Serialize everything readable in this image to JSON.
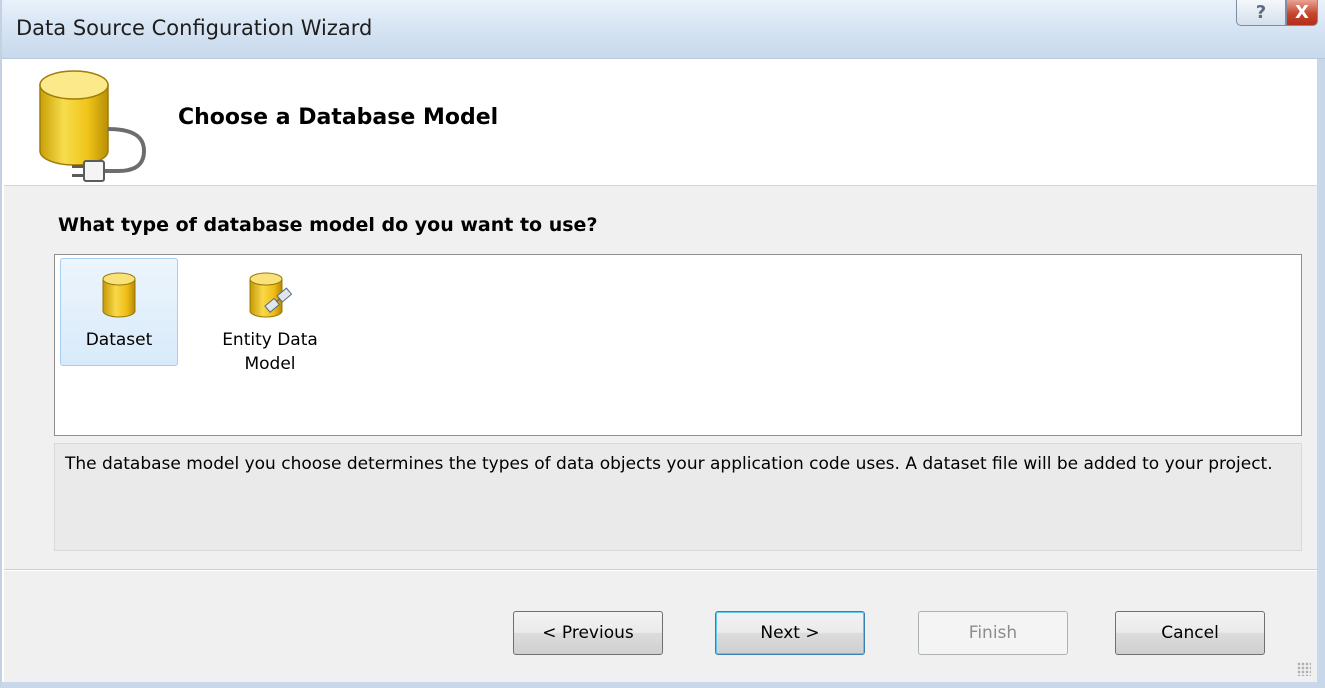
{
  "window": {
    "title": "Data Source Configuration Wizard",
    "help_glyph": "?",
    "close_glyph": "X"
  },
  "header": {
    "title": "Choose a Database Model",
    "icon": "database-plug-icon"
  },
  "main": {
    "question": "What type of database model do you want to use?",
    "options": [
      {
        "label": "Dataset",
        "icon": "dataset-icon",
        "selected": true
      },
      {
        "label": "Entity Data Model",
        "icon": "entity-data-model-icon",
        "selected": false
      }
    ],
    "description": "The database model you choose determines the types of data objects your application code uses. A dataset file will be added to your project."
  },
  "footer": {
    "previous_label": "< Previous",
    "next_label": "Next >",
    "finish_label": "Finish",
    "cancel_label": "Cancel"
  },
  "colors": {
    "cylinder": "#f0c419",
    "selection": "#d8eafa",
    "titlebar": "#d7e5f4"
  }
}
